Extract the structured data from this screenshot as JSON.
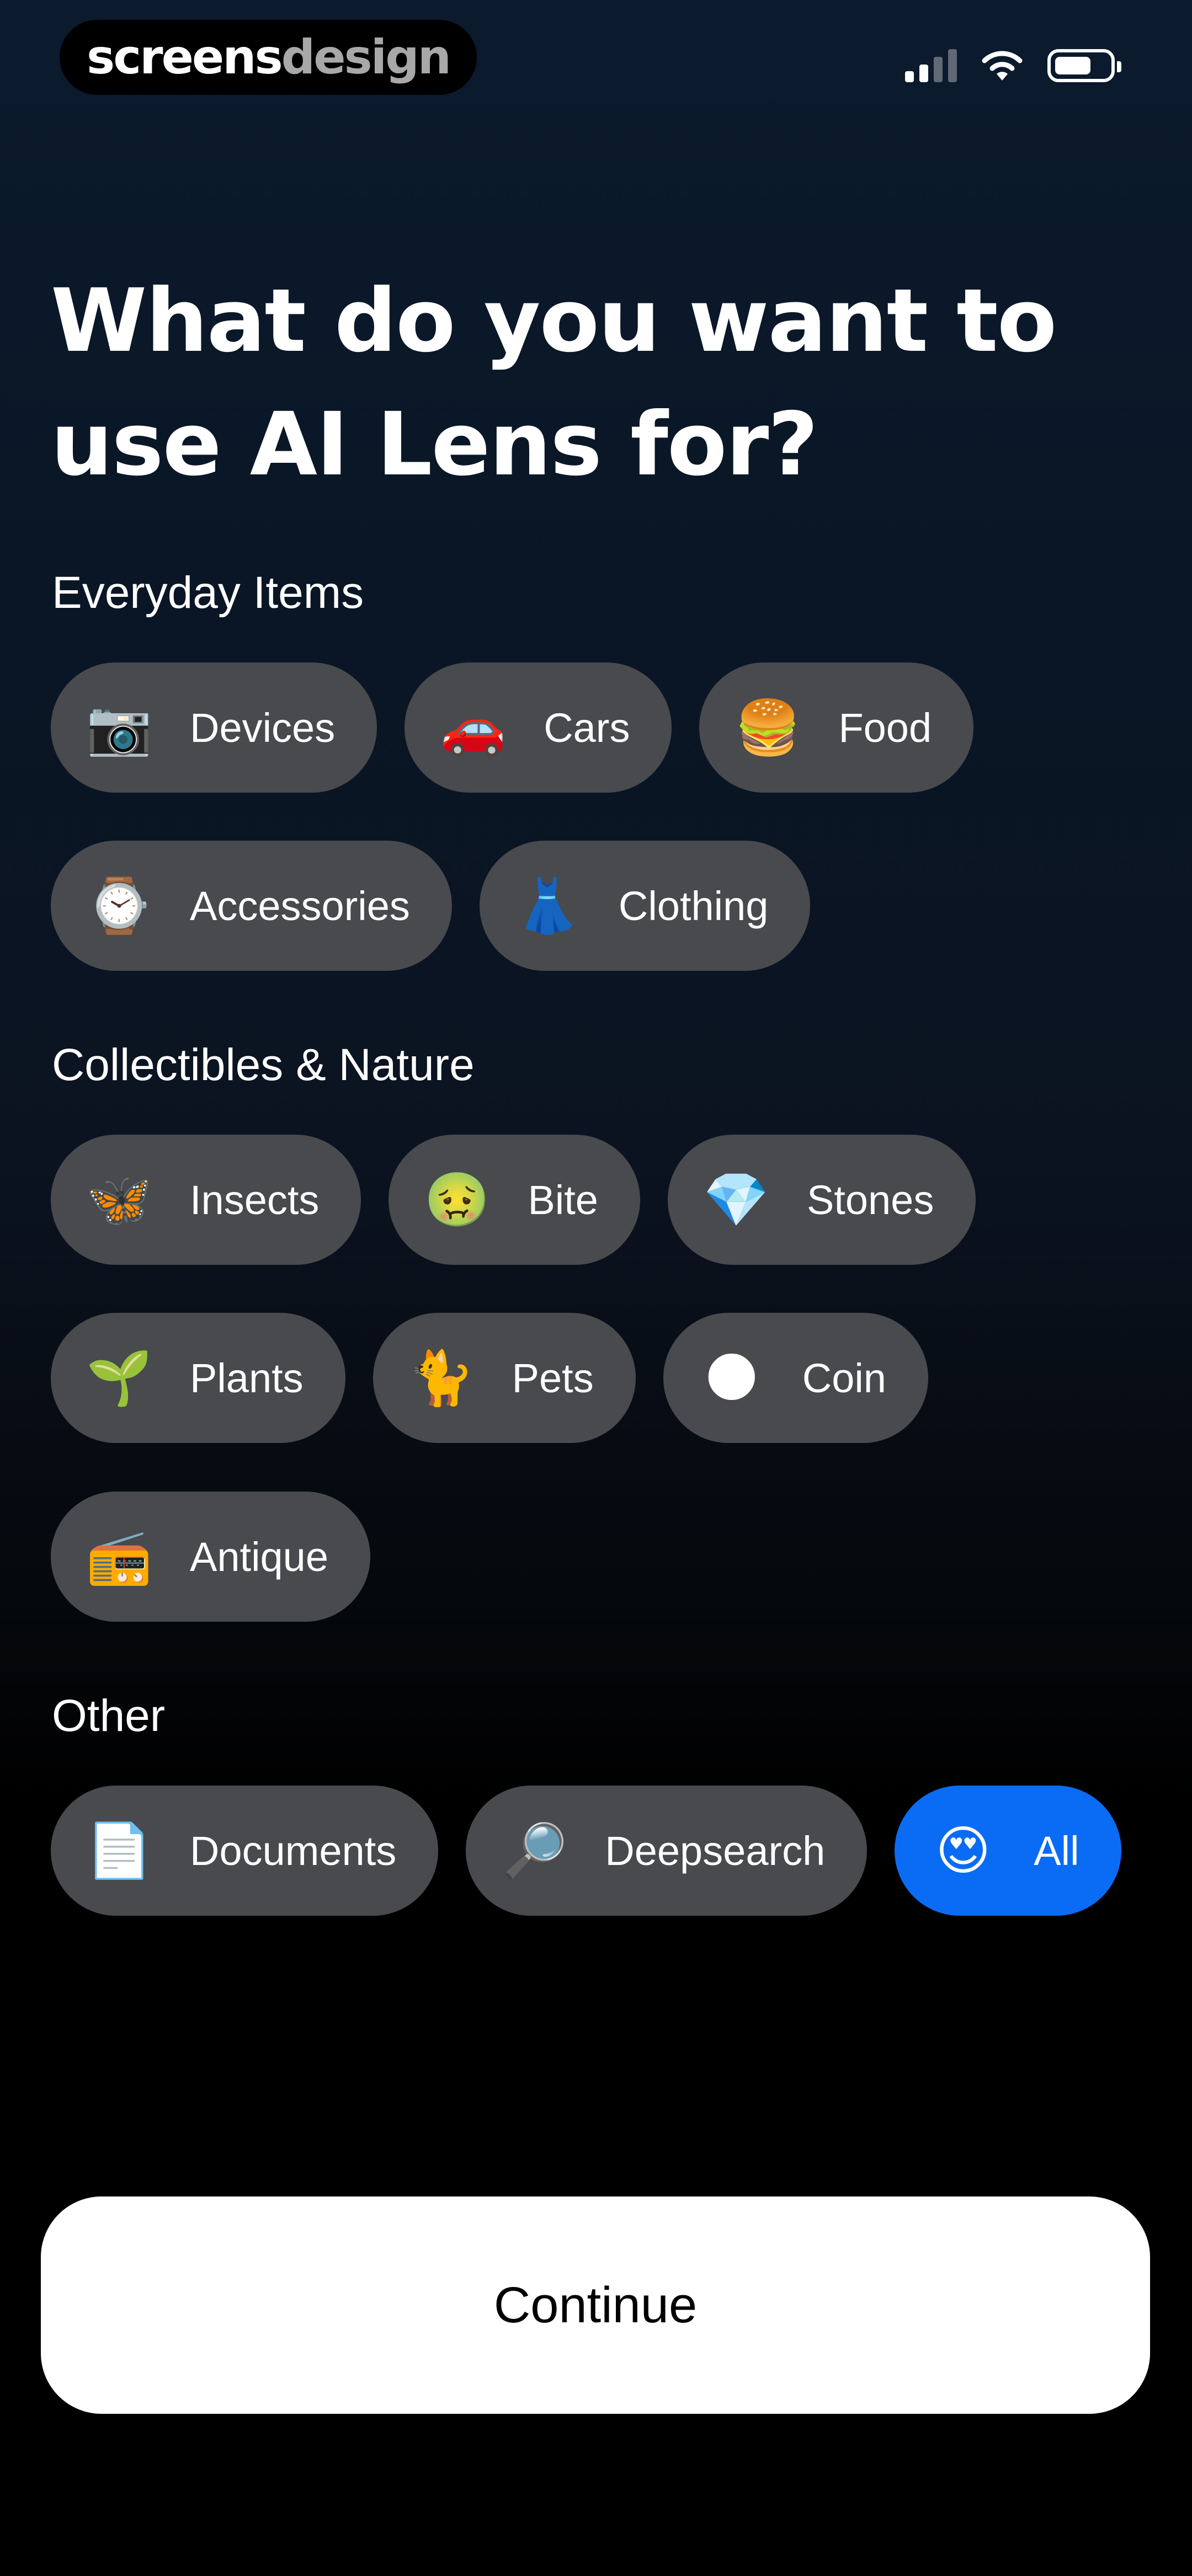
{
  "brand": {
    "part1": "screens",
    "part2": "design"
  },
  "status_bar": {
    "icons": [
      "signal-icon",
      "wifi-icon",
      "battery-icon"
    ]
  },
  "title": "What do you want to use AI Lens for?",
  "sections": [
    {
      "label": "Everyday Items",
      "items": [
        {
          "emoji": "📷",
          "icon": "camera-icon",
          "label": "Devices"
        },
        {
          "emoji": "🚗",
          "icon": "car-icon",
          "label": "Cars"
        },
        {
          "emoji": "🍔",
          "icon": "burger-icon",
          "label": "Food"
        },
        {
          "emoji": "⌚",
          "icon": "watch-icon",
          "label": "Accessories"
        },
        {
          "emoji": "👗",
          "icon": "dress-icon",
          "label": "Clothing"
        }
      ]
    },
    {
      "label": "Collectibles & Nature",
      "items": [
        {
          "emoji": "🦋",
          "icon": "butterfly-icon",
          "label": "Insects"
        },
        {
          "emoji": "🤢",
          "icon": "nauseated-face-icon",
          "label": "Bite"
        },
        {
          "emoji": "💎",
          "icon": "gem-icon",
          "label": "Stones"
        },
        {
          "emoji": "🌱",
          "icon": "seedling-icon",
          "label": "Plants"
        },
        {
          "emoji": "🐈",
          "icon": "cat-icon",
          "label": "Pets"
        },
        {
          "emoji": "🌑",
          "icon": "coin-icon",
          "label": "Coin"
        },
        {
          "emoji": "📻",
          "icon": "radio-icon",
          "label": "Antique"
        }
      ]
    },
    {
      "label": "Other",
      "items": [
        {
          "emoji": "📄",
          "icon": "document-icon",
          "label": "Documents"
        },
        {
          "emoji": "🔎",
          "icon": "magnifier-icon",
          "label": "Deepsearch"
        },
        {
          "emoji": "😍",
          "icon": "heart-eyes-icon",
          "label": "All",
          "selected": true
        }
      ]
    }
  ],
  "continue_label": "Continue",
  "colors": {
    "chip_bg": "#484a4e",
    "selected_chip_bg": "#0a6cf5",
    "button_bg": "#ffffff"
  }
}
